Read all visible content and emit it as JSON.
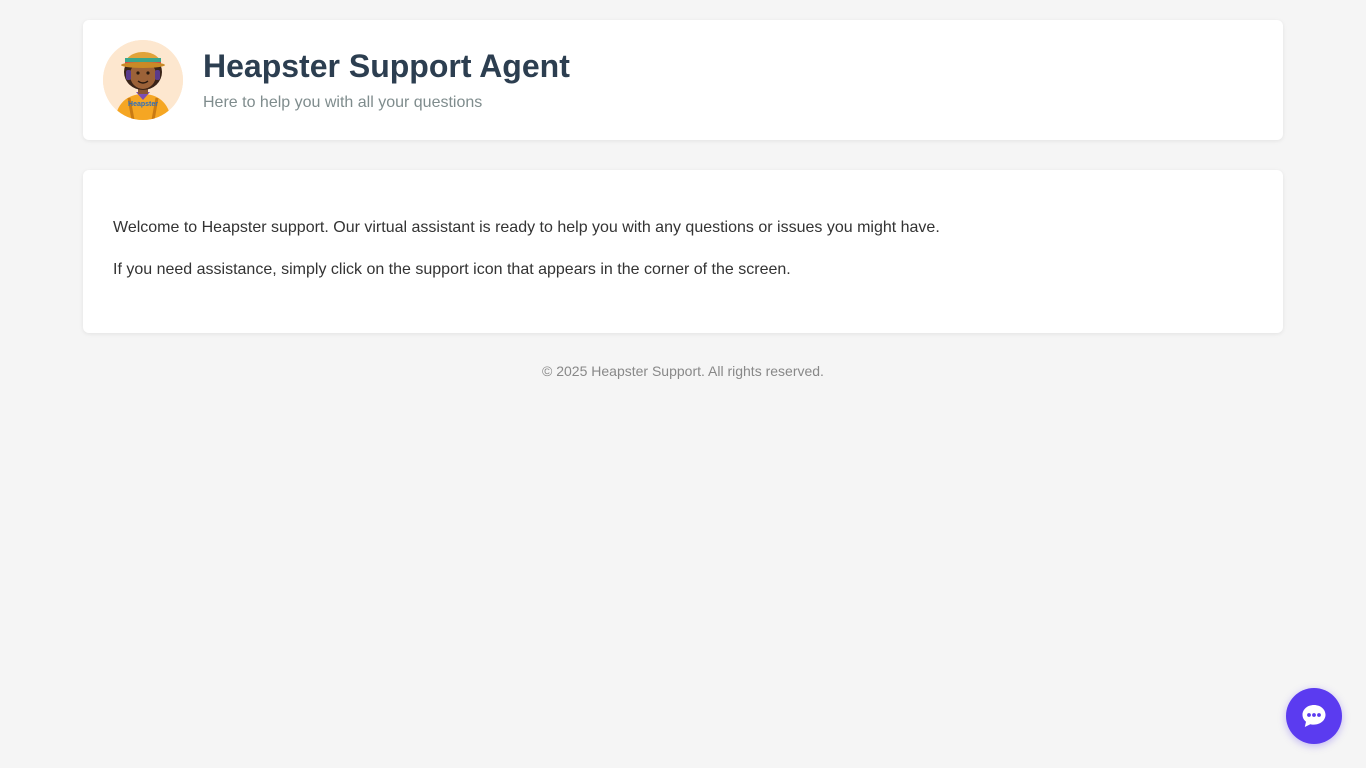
{
  "header": {
    "title": "Heapster Support Agent",
    "subtitle": "Here to help you with all your questions",
    "avatar": {
      "icon": "support-agent-avatar",
      "brand_text": "Heapster"
    }
  },
  "content": {
    "paragraphs": [
      "Welcome to Heapster support. Our virtual assistant is ready to help you with any questions or issues you might have.",
      "If you need assistance, simply click on the support icon that appears in the corner of the screen."
    ]
  },
  "footer": {
    "text": "© 2025 Heapster Support. All rights reserved."
  },
  "chat_widget": {
    "icon": "chat-bubble-icon",
    "color": "#5b3bf0"
  },
  "colors": {
    "background": "#f5f5f5",
    "title": "#2c3e50",
    "subtitle": "#7f8c8d",
    "accent": "#5b3bf0"
  }
}
